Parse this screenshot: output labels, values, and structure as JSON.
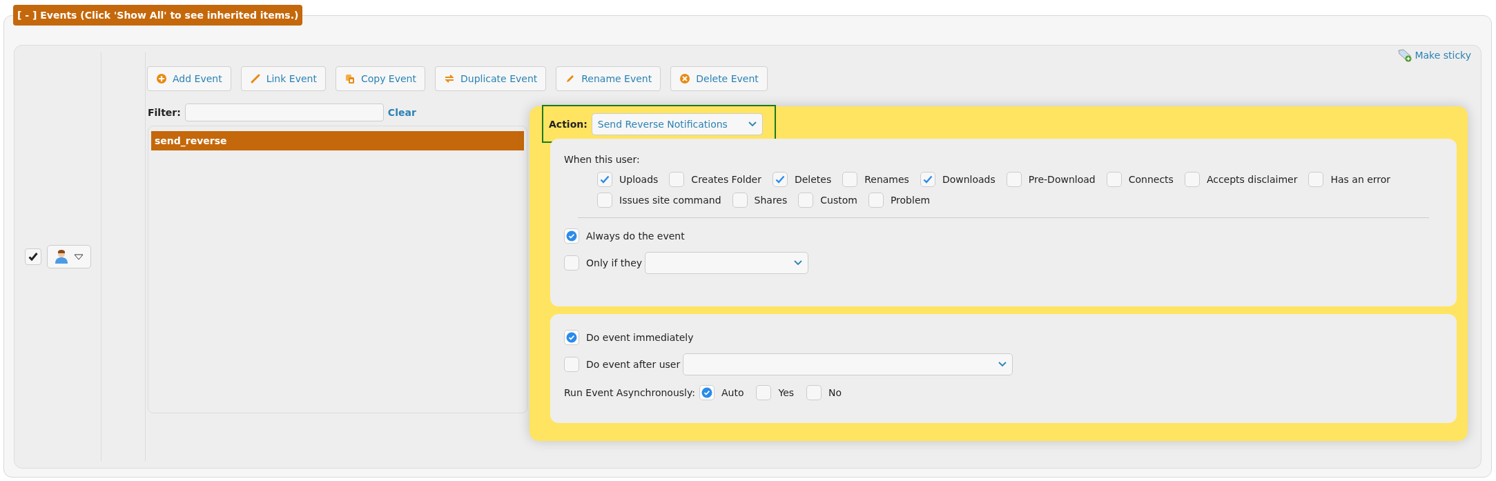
{
  "section_header": "[ - ] Events (Click 'Show All' to see inherited items.)",
  "make_sticky": "Make sticky",
  "left_column": {
    "checked": true
  },
  "toolbar": [
    {
      "label": "Add Event"
    },
    {
      "label": "Link Event"
    },
    {
      "label": "Copy Event"
    },
    {
      "label": "Duplicate Event"
    },
    {
      "label": "Rename Event"
    },
    {
      "label": "Delete Event"
    }
  ],
  "filter": {
    "label": "Filter:",
    "clear": "Clear"
  },
  "events": [
    {
      "name": "send_reverse",
      "selected": true
    }
  ],
  "action": {
    "label": "Action:",
    "value": "Send Reverse Notifications"
  },
  "triggers": {
    "title": "When this user:",
    "options": [
      {
        "label": "Uploads",
        "checked": true
      },
      {
        "label": "Creates Folder",
        "checked": false
      },
      {
        "label": "Deletes",
        "checked": true
      },
      {
        "label": "Renames",
        "checked": false
      },
      {
        "label": "Downloads",
        "checked": true
      },
      {
        "label": "Pre-Download",
        "checked": false
      },
      {
        "label": "Connects",
        "checked": false
      },
      {
        "label": "Accepts disclaimer",
        "checked": false
      },
      {
        "label": "Has an error",
        "checked": false
      },
      {
        "label": "Issues site command",
        "checked": false
      },
      {
        "label": "Shares",
        "checked": false
      },
      {
        "label": "Custom",
        "checked": false
      },
      {
        "label": "Problem",
        "checked": false
      }
    ]
  },
  "condition": [
    {
      "kind": "check",
      "label": "Always do the event",
      "checked": true
    },
    {
      "kind": "select",
      "label": "Only if they",
      "checked": false
    }
  ],
  "timing": [
    {
      "kind": "check",
      "label": "Do event immediately",
      "checked": true
    },
    {
      "kind": "select",
      "label": "Do event after user",
      "checked": false
    }
  ],
  "async": {
    "label": "Run Event Asynchronously:",
    "options": [
      {
        "label": "Auto",
        "selected": true
      },
      {
        "label": "Yes",
        "selected": false
      },
      {
        "label": "No",
        "selected": false
      }
    ]
  }
}
